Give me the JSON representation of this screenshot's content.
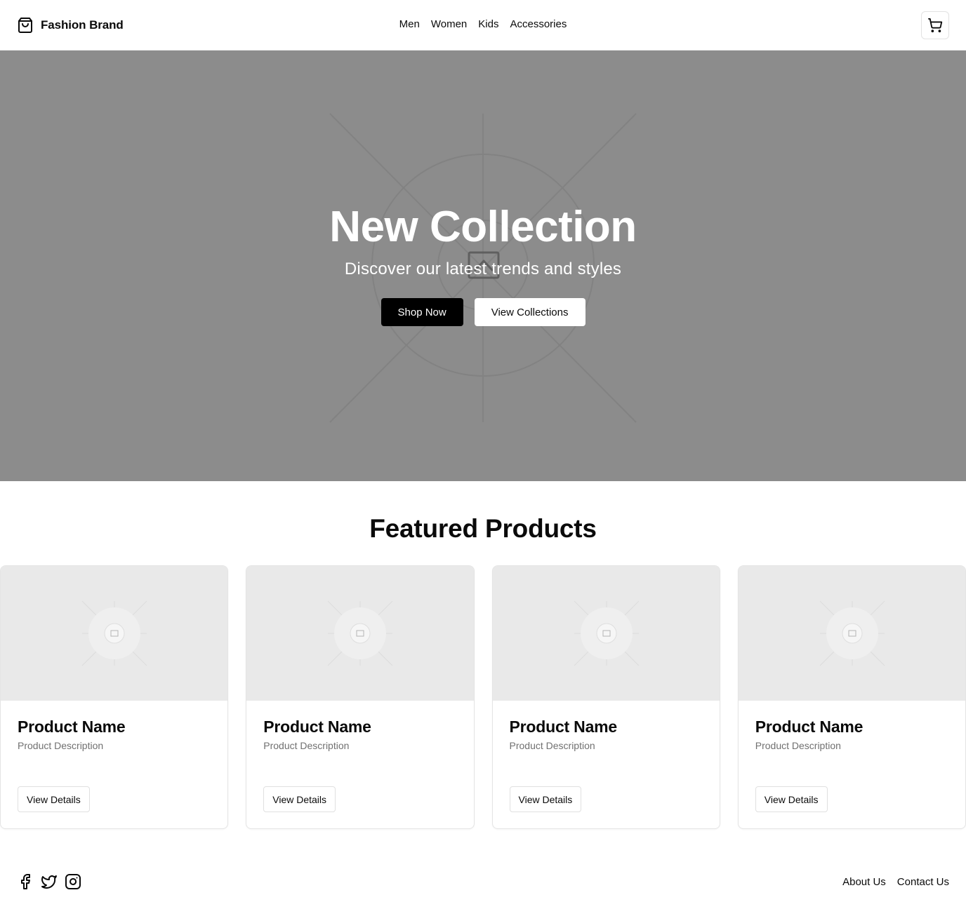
{
  "header": {
    "brand_name": "Fashion Brand",
    "brand_icon": "shopping-bag-icon",
    "nav": [
      {
        "label": "Men"
      },
      {
        "label": "Women"
      },
      {
        "label": "Kids"
      },
      {
        "label": "Accessories"
      }
    ],
    "cart_icon": "shopping-cart-icon"
  },
  "hero": {
    "title": "New Collection",
    "subtitle": "Discover our latest trends and styles",
    "primary_button": "Shop Now",
    "secondary_button": "View Collections",
    "background_color": "#8c8c8c"
  },
  "featured": {
    "title": "Featured Products",
    "products": [
      {
        "name": "Product Name",
        "description": "Product Description",
        "button": "View Details"
      },
      {
        "name": "Product Name",
        "description": "Product Description",
        "button": "View Details"
      },
      {
        "name": "Product Name",
        "description": "Product Description",
        "button": "View Details"
      },
      {
        "name": "Product Name",
        "description": "Product Description",
        "button": "View Details"
      }
    ]
  },
  "footer": {
    "social_icons": [
      "facebook-icon",
      "twitter-icon",
      "instagram-icon"
    ],
    "links": [
      {
        "label": "About Us"
      },
      {
        "label": "Contact Us"
      }
    ]
  },
  "colors": {
    "primary_button_bg": "#000000",
    "hero_text": "#ffffff",
    "placeholder_bg": "#e9e9e9",
    "muted_text": "#707070"
  }
}
